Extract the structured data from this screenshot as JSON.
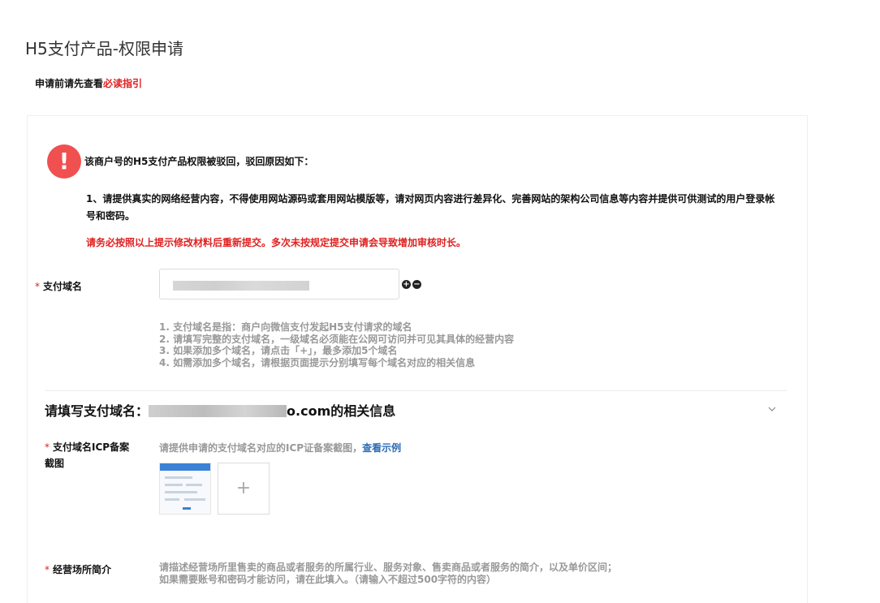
{
  "page": {
    "title": "H5支付产品-权限申请",
    "guide_prefix": "申请前请先查看",
    "guide_link": "必读指引"
  },
  "alert": {
    "icon": "!",
    "title": "该商户号的H5支付产品权限被驳回，驳回原因如下：",
    "reason": "1、请提供真实的网络经营内容，不得使用网站源码或套用网站模版等，请对网页内容进行差异化、完善网站的架构公司信息等内容并提供可供测试的用户登录帐号和密码。",
    "warning": "请务必按照以上提示修改材料后重新提交。多次未按规定提交申请会导致增加审核时长。"
  },
  "domain_field": {
    "required_mark": "*",
    "label": "支付域名",
    "value": "",
    "add_icon": "+",
    "remove_icon": "−",
    "hints": [
      "1. 支付域名是指：商户向微信支付发起H5支付请求的域名",
      "2. 请填写完整的支付域名，一级域名必须能在公网可访问并可见其具体的经营内容",
      "3. 如果添加多个域名，请点击「+」，最多添加5个域名",
      "4. 如需添加多个域名，请根据页面提示分别填写每个域名对应的相关信息"
    ]
  },
  "domain_section": {
    "prefix": "请填写支付域名：",
    "suffix": "o.com的相关信息"
  },
  "icp_field": {
    "required_mark": "*",
    "label_line1": "支付域名ICP备案",
    "label_line2": "截图",
    "desc": "请提供申请的支付域名对应的ICP证备案截图，",
    "example_link": "查看示例",
    "upload_icon": "+"
  },
  "business_field": {
    "required_mark": "*",
    "label": "经营场所简介",
    "desc_line1": "请描述经营场所里售卖的商品或者服务的所属行业、服务对象、售卖商品或者服务的简介，以及单价区间；",
    "desc_line2": "如果需要账号和密码才能访问，请在此填入。（请输入不超过500字符的内容）"
  }
}
